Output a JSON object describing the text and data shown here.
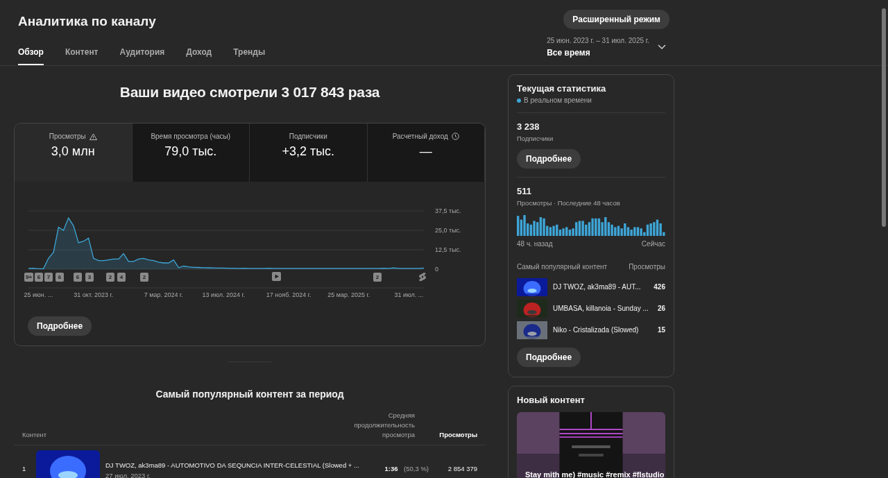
{
  "header": {
    "title": "Аналитика по каналу",
    "advanced_button": "Расширенный режим",
    "tabs": [
      {
        "label": "Обзор",
        "selected": true
      },
      {
        "label": "Контент",
        "selected": false
      },
      {
        "label": "Аудитория",
        "selected": false
      },
      {
        "label": "Доход",
        "selected": false
      },
      {
        "label": "Тренды",
        "selected": false
      }
    ],
    "period": {
      "range": "25 июн. 2023 г. – 31 июл. 2025 г.",
      "value": "Все время"
    }
  },
  "headline": "Ваши видео смотрели 3 017 843 раза",
  "metrics": [
    {
      "label": "Просмотры",
      "value": "3,0 млн",
      "selected": true,
      "kind": "warning"
    },
    {
      "label": "Время просмотра (часы)",
      "value": "79,0 тыс.",
      "selected": false,
      "kind": "plain"
    },
    {
      "label": "Подписчики",
      "value": "+3,2 тыс.",
      "selected": false,
      "kind": "plain"
    },
    {
      "label": "Расчетный доход",
      "value": "—",
      "selected": false,
      "kind": "clock"
    }
  ],
  "chart_data": {
    "type": "area",
    "ylim": [
      0,
      37.5
    ],
    "grid": true,
    "yticks": [
      0,
      {
        "value": 12.5,
        "label": "12,5 тыс."
      },
      {
        "value": 25,
        "label": "25,0 тыс."
      },
      {
        "value": 37.5,
        "label": "37,5 тыс."
      }
    ],
    "categories": [
      null,
      null,
      "25 июн. ...",
      null,
      null,
      null,
      null,
      null,
      null,
      null,
      null,
      null,
      null,
      "31 окт. 2023 г.",
      null,
      null,
      null,
      null,
      null,
      null,
      null,
      null,
      null,
      null,
      null,
      null,
      null,
      "7 мар. 2024 г.",
      null,
      null,
      null,
      null,
      null,
      null,
      null,
      null,
      null,
      null,
      null,
      "13 июл. 2024 г.",
      null,
      null,
      null,
      null,
      null,
      null,
      null,
      null,
      null,
      null,
      null,
      null,
      "17 нояб. 2024 г.",
      null,
      null,
      null,
      null,
      null,
      null,
      null,
      null,
      null,
      null,
      null,
      "25 мар. 2025 г.",
      null,
      null,
      null,
      null,
      null,
      null,
      null,
      null,
      null,
      null,
      null,
      "31 июл. ...",
      null,
      null,
      null
    ],
    "series": [
      {
        "color": "#3ea6d8",
        "values": [
          0.5,
          0.6,
          0.3,
          0.3,
          7,
          10.9,
          27,
          25,
          33,
          28,
          17,
          18,
          20,
          7,
          5.5,
          5.5,
          6,
          6.5,
          6.5,
          10,
          5,
          5,
          6.5,
          7,
          6,
          5.5,
          4.5,
          4,
          4,
          6,
          1,
          2,
          1.5,
          1.2,
          1.1,
          1,
          0.9,
          0.8,
          0.7,
          0.7,
          0.6,
          0.6,
          0.5,
          0.6,
          0.5,
          0.5,
          0.5,
          0.5,
          0.6,
          0.5,
          0.5,
          0.5,
          0.5,
          0.5,
          0.5,
          0.5,
          0.5,
          0.5,
          0.5,
          0.5,
          0.5,
          0.5,
          0.5,
          0.5,
          0.5,
          0.5,
          0.5,
          0.5,
          0.5,
          0.5,
          0.5,
          0.6,
          0.5,
          0.8,
          0.5,
          0.5,
          0.5,
          0.5,
          0.5,
          0.7
        ]
      }
    ],
    "annotations": [
      "9+",
      "6",
      "7",
      "6",
      "6",
      "3",
      "2",
      "4",
      "2",
      "2"
    ]
  },
  "timeline_icons": [
    {
      "kind": "video"
    },
    {
      "kind": "short"
    }
  ],
  "more_button": "Подробнее",
  "top_content": {
    "title": "Самый популярный контент за период",
    "columns": [
      "Контент",
      "Средняя продолжительность просмотра",
      "Просмотры"
    ],
    "rows": [
      {
        "rank": "1",
        "title": "DJ TWOZ, ak3ma89 - AUTOMOTIVO DA SEQUNCIA INTER-CELESTIAL (Slowed + ...",
        "date": "27 июл. 2023 г.",
        "duration": "1:36",
        "percent": "(50,3 %)",
        "views": "2 854 379"
      }
    ]
  },
  "realtime": {
    "title": "Текущая статистика",
    "live": "В реальном времени",
    "subscribers": "3 238",
    "subscribers_label": "Подписчики",
    "subscribers_button": "Подробнее",
    "views": "511",
    "views_label": "Просмотры · Последние 48 часов",
    "axis_start": "48 ч. назад",
    "axis_end": "Сейчас",
    "list_title": "Самый популярный контент",
    "list_metric": "Просмотры",
    "items": [
      {
        "title": "DJ TWOZ, ak3ma89 - AUT...",
        "views": "426"
      },
      {
        "title": "UMBASA, killanoia - Sunday ...",
        "views": "26"
      },
      {
        "title": "Niko - Cristalizada (Slowed)",
        "views": "15"
      }
    ],
    "more_button": "Подробнее"
  },
  "new_content": {
    "title": "Новый контент",
    "caption": "Stay mith me) #music #remix #flstudio"
  }
}
